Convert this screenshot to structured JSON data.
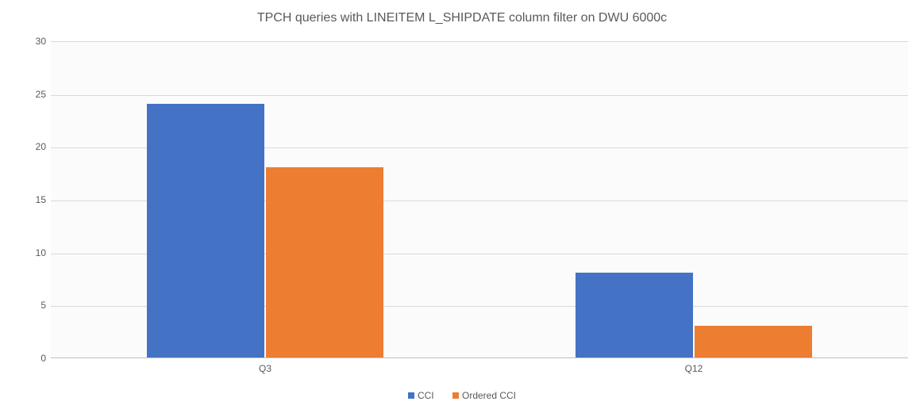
{
  "chart_data": {
    "type": "bar",
    "title": "TPCH queries with LINEITEM L_SHIPDATE column filter on DWU 6000c",
    "categories": [
      "Q3",
      "Q12"
    ],
    "series": [
      {
        "name": "CCI",
        "values": [
          24,
          8
        ],
        "color": "#4472c4"
      },
      {
        "name": "Ordered CCI",
        "values": [
          18,
          3
        ],
        "color": "#ed7d31"
      }
    ],
    "xlabel": "",
    "ylabel": "",
    "ylim": [
      0,
      30
    ],
    "ytick_step": 5,
    "grid": true,
    "legend_position": "bottom"
  }
}
